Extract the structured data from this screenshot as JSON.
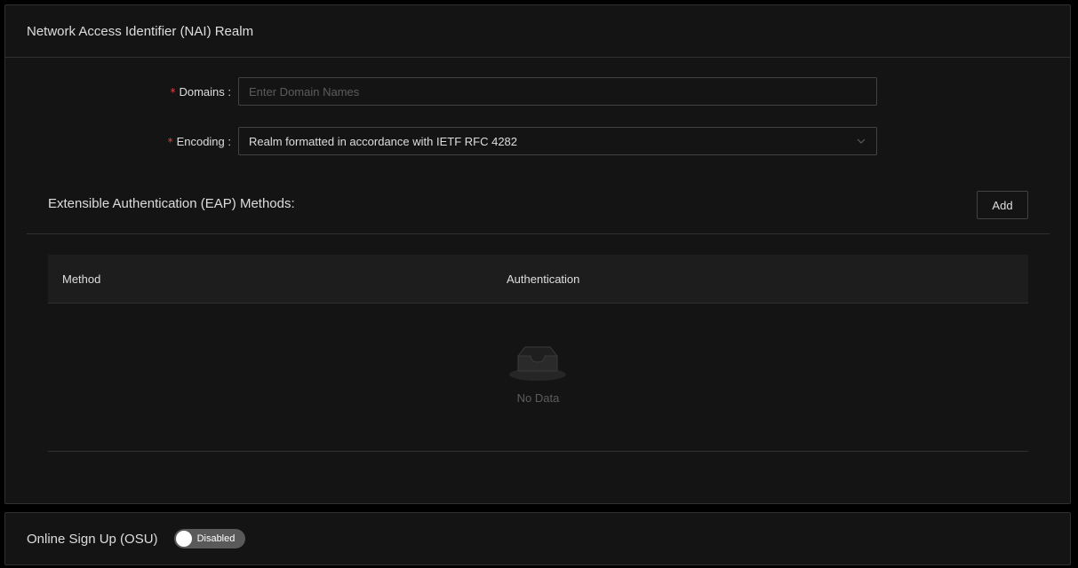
{
  "nai_realm": {
    "title": "Network Access Identifier (NAI) Realm",
    "domains": {
      "required_mark": "*",
      "label": "Domains :",
      "value": "",
      "placeholder": "Enter Domain Names"
    },
    "encoding": {
      "required_mark": "*",
      "label": "Encoding :",
      "selected": "Realm formatted in accordance with IETF RFC 4282",
      "icon": "chevron-down-icon"
    },
    "eap": {
      "title": "Extensible Authentication (EAP) Methods:",
      "add_label": "Add",
      "table": {
        "columns": [
          "Method",
          "Authentication"
        ],
        "rows": [],
        "empty_icon": "empty-inbox-icon",
        "empty_text": "No Data"
      }
    }
  },
  "osu": {
    "title": "Online Sign Up (OSU)",
    "toggle": {
      "state": "off",
      "label": "Disabled"
    }
  },
  "colors": {
    "background": "#000000",
    "card": "#141414",
    "border": "#303030",
    "required": "#dc4446"
  }
}
